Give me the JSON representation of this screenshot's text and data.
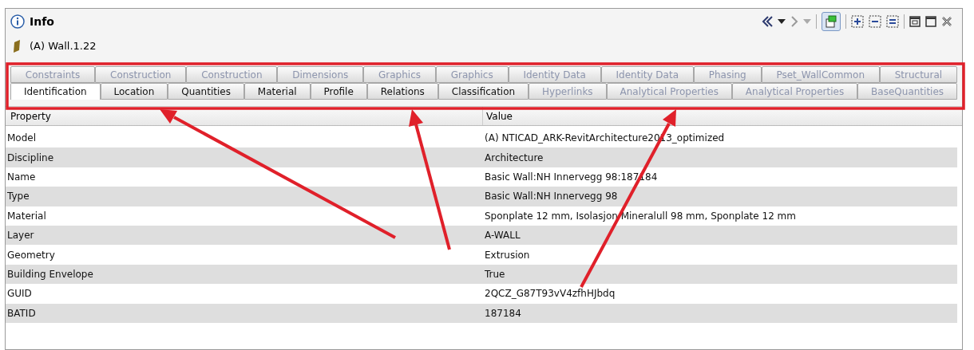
{
  "window": {
    "title": "Info"
  },
  "element": {
    "label": "(A) Wall.1.22"
  },
  "tab_rows": [
    [
      {
        "label": "Constraints",
        "selected": false,
        "disabled": true
      },
      {
        "label": "Construction",
        "selected": false,
        "disabled": true
      },
      {
        "label": "Construction",
        "selected": false,
        "disabled": true
      },
      {
        "label": "Dimensions",
        "selected": false,
        "disabled": true
      },
      {
        "label": "Graphics",
        "selected": false,
        "disabled": true
      },
      {
        "label": "Graphics",
        "selected": false,
        "disabled": true
      },
      {
        "label": "Identity Data",
        "selected": false,
        "disabled": true
      },
      {
        "label": "Identity Data",
        "selected": false,
        "disabled": true
      },
      {
        "label": "Phasing",
        "selected": false,
        "disabled": true
      },
      {
        "label": "Pset_WallCommon",
        "selected": false,
        "disabled": true
      },
      {
        "label": "Structural",
        "selected": false,
        "disabled": true
      }
    ],
    [
      {
        "label": "Identification",
        "selected": true,
        "disabled": false
      },
      {
        "label": "Location",
        "selected": false,
        "disabled": false
      },
      {
        "label": "Quantities",
        "selected": false,
        "disabled": false
      },
      {
        "label": "Material",
        "selected": false,
        "disabled": false
      },
      {
        "label": "Profile",
        "selected": false,
        "disabled": false
      },
      {
        "label": "Relations",
        "selected": false,
        "disabled": false
      },
      {
        "label": "Classification",
        "selected": false,
        "disabled": false
      },
      {
        "label": "Hyperlinks",
        "selected": false,
        "disabled": true
      },
      {
        "label": "Analytical Properties",
        "selected": false,
        "disabled": true
      },
      {
        "label": "Analytical Properties",
        "selected": false,
        "disabled": true
      },
      {
        "label": "BaseQuantities",
        "selected": false,
        "disabled": true
      }
    ]
  ],
  "table": {
    "columns": [
      "Property",
      "Value"
    ],
    "rows": [
      [
        "Model",
        "(A) NTICAD_ARK-RevitArchitecture2013_optimized"
      ],
      [
        "Discipline",
        "Architecture"
      ],
      [
        "Name",
        "Basic Wall:NH Innervegg 98:187184"
      ],
      [
        "Type",
        "Basic Wall:NH Innervegg 98"
      ],
      [
        "Material",
        "Sponplate 12 mm, Isolasjon Mineralull 98 mm, Sponplate 12 mm"
      ],
      [
        "Layer",
        "A-WALL"
      ],
      [
        "Geometry",
        "Extrusion"
      ],
      [
        "Building Envelope",
        "True"
      ],
      [
        "GUID",
        "2QCZ_G87T93vV4zfhHJbdq"
      ],
      [
        "BATID",
        "187184"
      ]
    ]
  }
}
